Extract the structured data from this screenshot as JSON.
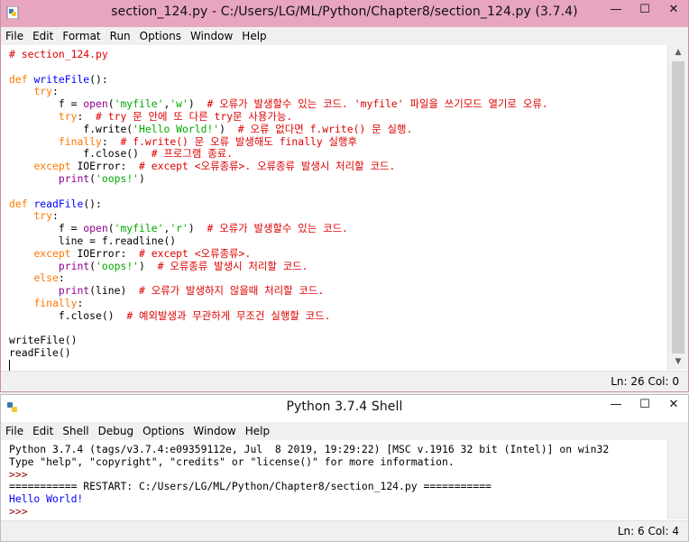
{
  "editor_window": {
    "title": "section_124.py - C:/Users/LG/ML/Python/Chapter8/section_124.py (3.7.4)",
    "menu": [
      "File",
      "Edit",
      "Format",
      "Run",
      "Options",
      "Window",
      "Help"
    ],
    "status": "Ln: 26  Col: 0",
    "code_lines": [
      "# section_124.py",
      "",
      "def writeFile():",
      "    try:",
      "        f = open('myfile','w')  # 오류가 발생할수 있는 코드. 'myfile' 파일을 쓰기모드 열기로 오류.",
      "        try:  # try 문 안에 또 다른 try문 사용가능.",
      "            f.write('Hello World!')  # 오류 없다면 f.write() 문 실행.",
      "        finally:  # f.write() 문 오류 발생해도 finally 실행후",
      "            f.close()  # 프로그램 종료.",
      "    except IOError:  # except <오류종류>. 오류종류 발생시 처리할 코드.",
      "        print('oops!')",
      "",
      "def readFile():",
      "    try:",
      "        f = open('myfile','r')  # 오류가 발생할수 있는 코드.",
      "        line = f.readline()",
      "    except IOError:  # except <오류종류>.",
      "        print('oops!')  # 오류종류 발생시 처리할 코드.",
      "    else:",
      "        print(line)  # 오류가 발생하지 않을때 처리할 코드.",
      "    finally:",
      "        f.close()  # 예외발생과 무관하게 무조건 실행할 코드.",
      "",
      "writeFile()",
      "readFile()",
      ""
    ]
  },
  "shell_window": {
    "title": "Python 3.7.4 Shell",
    "menu": [
      "File",
      "Edit",
      "Shell",
      "Debug",
      "Options",
      "Window",
      "Help"
    ],
    "status": "Ln: 6  Col: 4",
    "lines": [
      "Python 3.7.4 (tags/v3.7.4:e09359112e, Jul  8 2019, 19:29:22) [MSC v.1916 32 bit (Intel)] on win32",
      "Type \"help\", \"copyright\", \"credits\" or \"license()\" for more information.",
      ">>> ",
      "=========== RESTART: C:/Users/LG/ML/Python/Chapter8/section_124.py ===========",
      "Hello World!",
      ">>> "
    ]
  },
  "window_buttons": {
    "minimize": "—",
    "maximize": "☐",
    "close": "✕"
  },
  "colors": {
    "editor_titlebar": "#e8a5c0",
    "keyword": "#ff7700",
    "builtin": "#900090",
    "def_name": "#0000ff",
    "string": "#00aa00",
    "comment": "#dd0000"
  }
}
